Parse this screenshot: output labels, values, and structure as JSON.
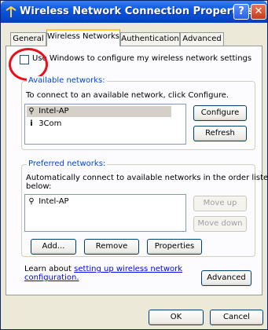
{
  "window": {
    "title": "Wireless Network Connection Properties",
    "help_label": "?",
    "close_label": "✕"
  },
  "tabs": [
    {
      "label": "General",
      "active": false
    },
    {
      "label": "Wireless Networks",
      "active": true
    },
    {
      "label": "Authentication",
      "active": false
    },
    {
      "label": "Advanced",
      "active": false
    }
  ],
  "use_windows_checkbox": {
    "label": "Use Windows to configure my wireless network settings",
    "checked": false
  },
  "available": {
    "group_title": "Available networks:",
    "description": "To connect to an available network, click Configure.",
    "networks": [
      {
        "name": "Intel-AP",
        "icon": "wireless-antenna-icon",
        "selected": true
      },
      {
        "name": "3Com",
        "icon": "adhoc-network-icon",
        "selected": false
      }
    ],
    "configure_label": "Configure",
    "refresh_label": "Refresh"
  },
  "preferred": {
    "group_title": "Preferred networks:",
    "description_line1": "Automatically connect to available networks in the order listed",
    "description_line2": "below:",
    "networks": [
      {
        "name": "Intel-AP",
        "icon": "wireless-antenna-icon",
        "selected": false
      }
    ],
    "move_up_label": "Move up",
    "move_down_label": "Move down",
    "add_label": "Add...",
    "remove_label": "Remove",
    "properties_label": "Properties"
  },
  "learn": {
    "prefix": "Learn about ",
    "link_line1": "setting up wireless network",
    "link_line2": "configuration.",
    "advanced_label": "Advanced"
  },
  "footer": {
    "ok_label": "OK",
    "cancel_label": "Cancel"
  }
}
